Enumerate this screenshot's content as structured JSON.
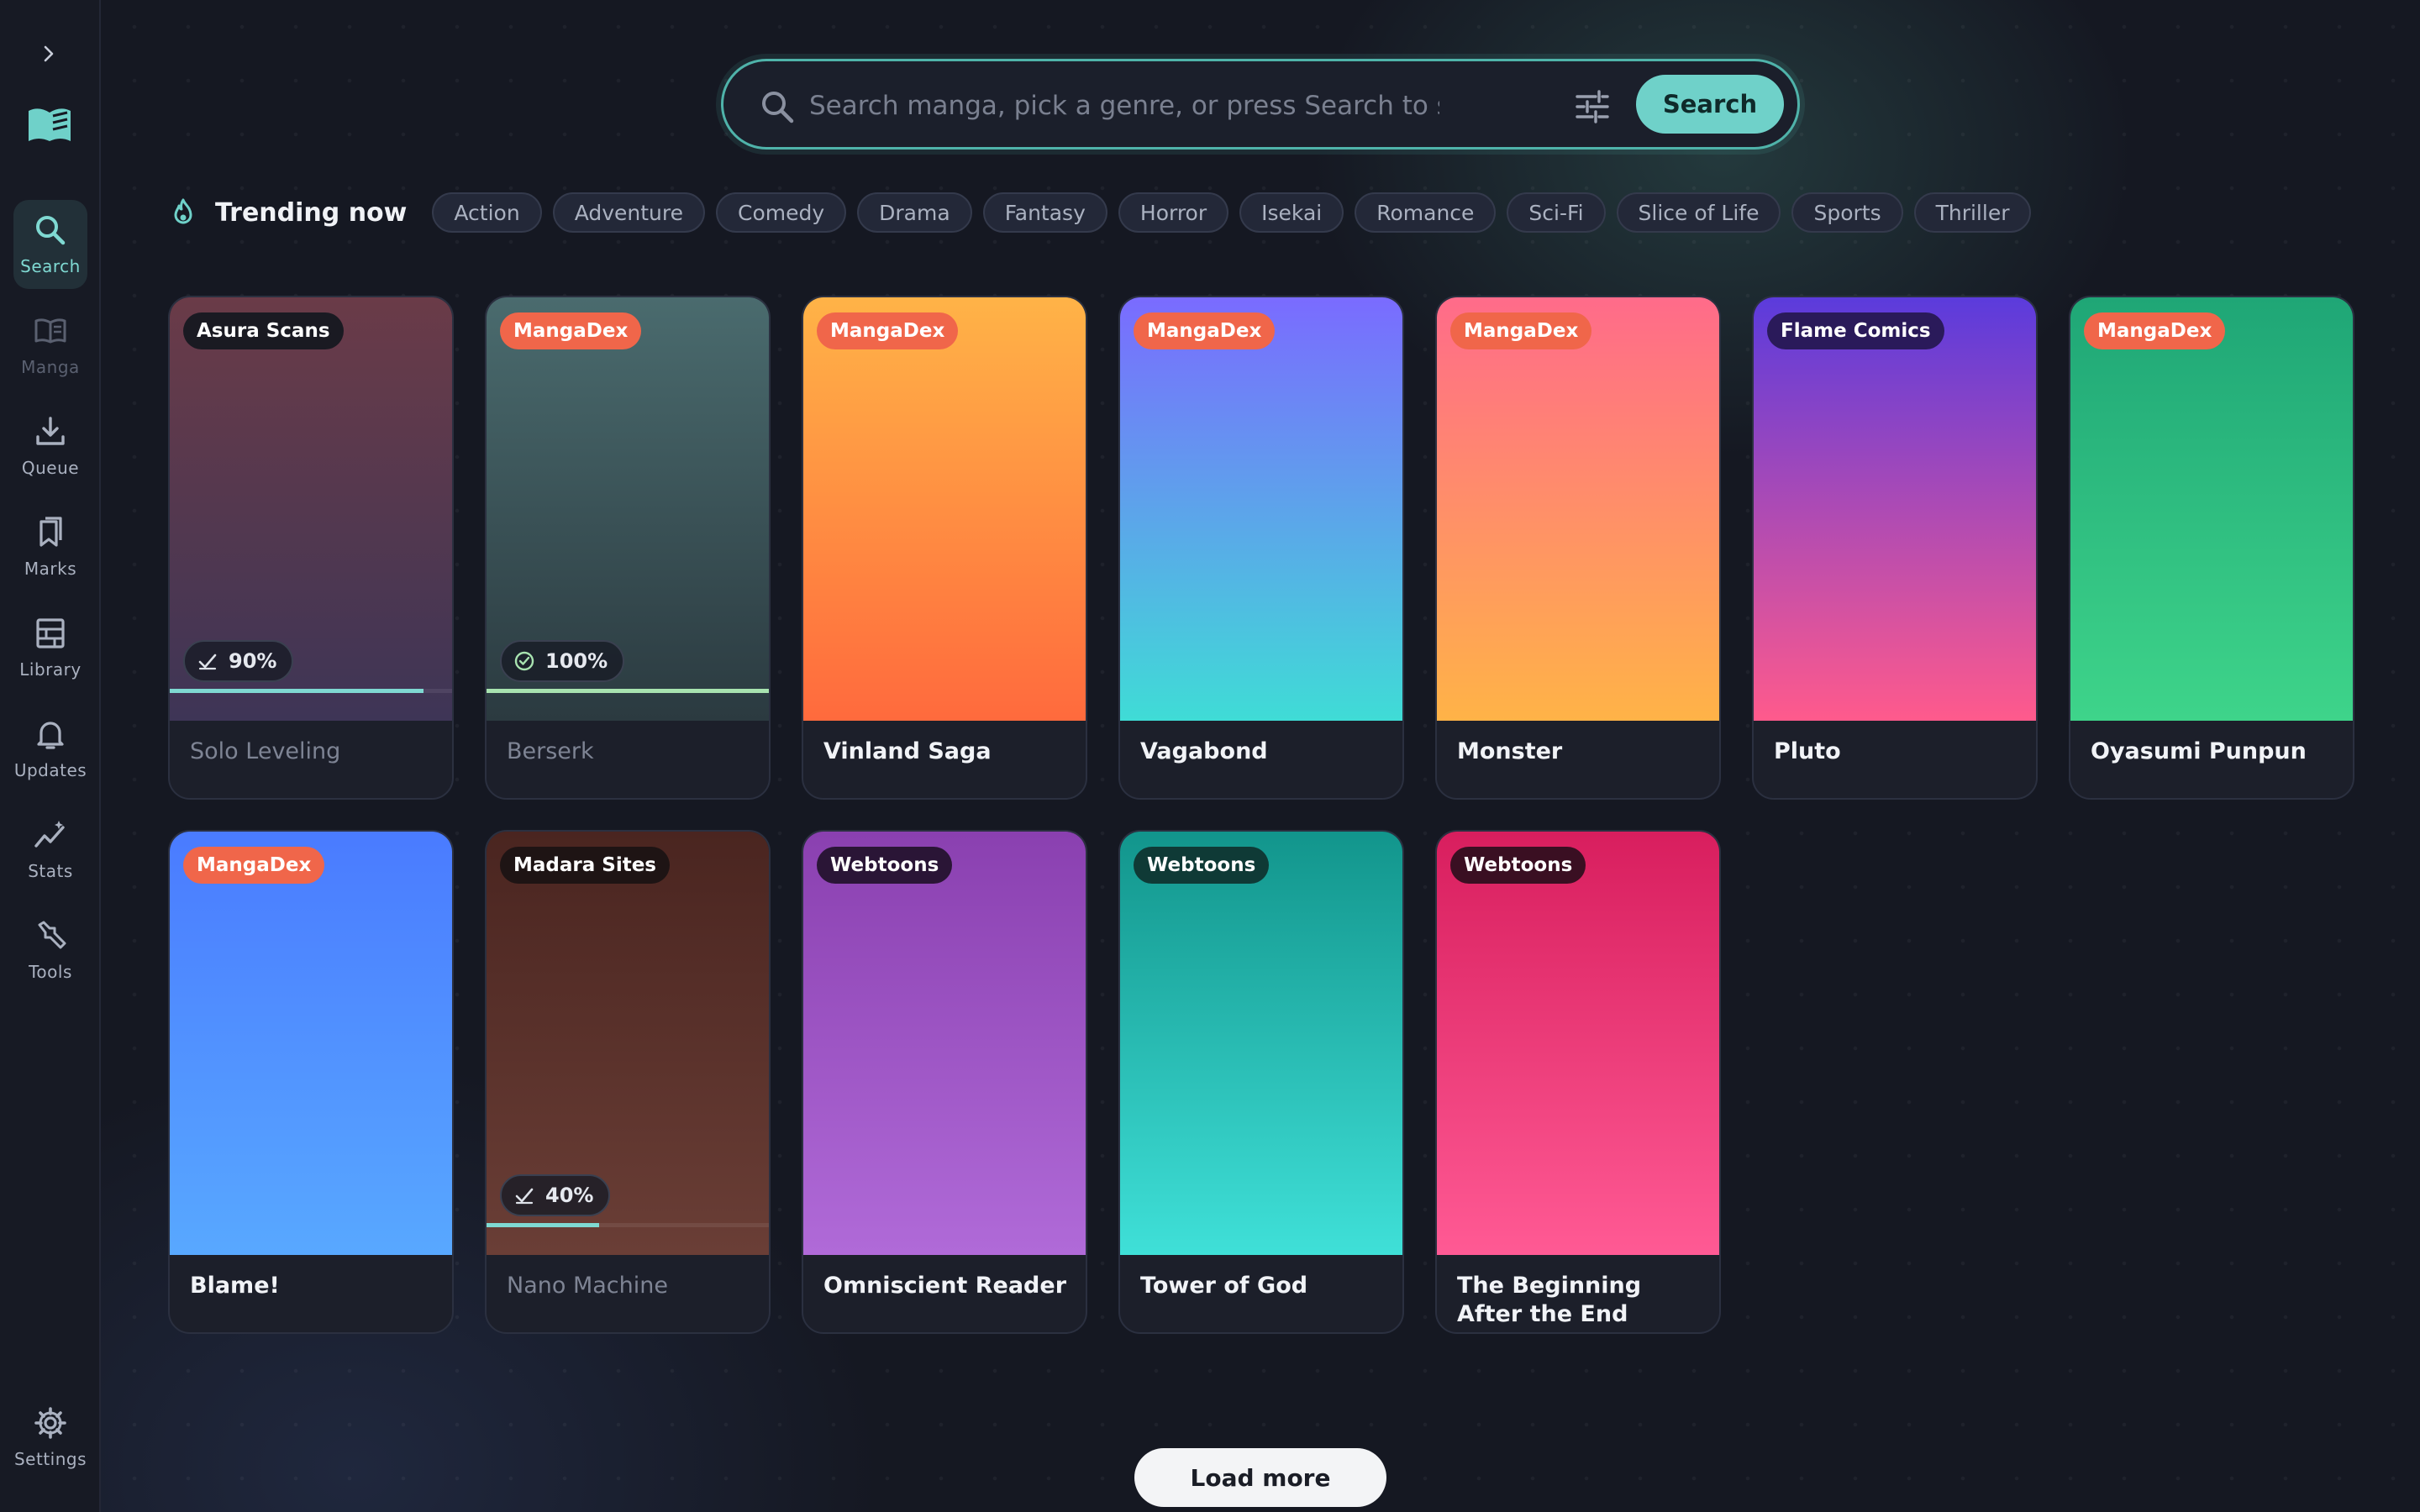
{
  "sidebar": {
    "items": [
      {
        "key": "search",
        "label": "Search",
        "icon": "search-icon",
        "active": true
      },
      {
        "key": "manga",
        "label": "Manga",
        "icon": "book-icon",
        "dim": true
      },
      {
        "key": "queue",
        "label": "Queue",
        "icon": "download-icon"
      },
      {
        "key": "marks",
        "label": "Marks",
        "icon": "bookmark-icon"
      },
      {
        "key": "library",
        "label": "Library",
        "icon": "library-icon"
      },
      {
        "key": "updates",
        "label": "Updates",
        "icon": "bell-icon"
      },
      {
        "key": "stats",
        "label": "Stats",
        "icon": "sparkline-icon"
      },
      {
        "key": "tools",
        "label": "Tools",
        "icon": "wrench-icon"
      }
    ],
    "settings_label": "Settings"
  },
  "search": {
    "placeholder": "Search manga, pick a genre, or press Search to see what's trending",
    "button_label": "Search"
  },
  "trending": {
    "title": "Trending now",
    "genres": [
      "Action",
      "Adventure",
      "Comedy",
      "Drama",
      "Fantasy",
      "Horror",
      "Isekai",
      "Romance",
      "Sci-Fi",
      "Slice of Life",
      "Sports",
      "Thriller"
    ]
  },
  "cards": [
    {
      "title": "Solo Leveling",
      "source": "Asura Scans",
      "badge_color": "#1a1a22",
      "grad": [
        "#6a3b48",
        "#3e3556"
      ],
      "progress": 90,
      "muted": true
    },
    {
      "title": "Berserk",
      "source": "MangaDex",
      "badge_color": "#f0664a",
      "grad": [
        "#4a6b6e",
        "#2b3a40"
      ],
      "progress": 100,
      "done": true,
      "muted": true
    },
    {
      "title": "Vinland Saga",
      "source": "MangaDex",
      "badge_color": "#f0664a",
      "grad": [
        "#ffb347",
        "#ff6a3d"
      ]
    },
    {
      "title": "Vagabond",
      "source": "MangaDex",
      "badge_color": "#f0664a",
      "grad": [
        "#7a6bff",
        "#3fdcd6"
      ]
    },
    {
      "title": "Monster",
      "source": "MangaDex",
      "badge_color": "#f0664a",
      "grad": [
        "#ff6b8a",
        "#ffb347"
      ]
    },
    {
      "title": "Pluto",
      "source": "Flame Comics",
      "badge_color": "#2a1a5a",
      "grad": [
        "#5b3bdc",
        "#ff5a8c"
      ]
    },
    {
      "title": "Oyasumi Punpun",
      "source": "MangaDex",
      "badge_color": "#f0664a",
      "grad": [
        "#1fa676",
        "#3ed48a"
      ]
    },
    {
      "title": "Blame!",
      "source": "MangaDex",
      "badge_color": "#f0664a",
      "grad": [
        "#4a7bff",
        "#58a8ff"
      ]
    },
    {
      "title": "Nano Machine",
      "source": "Madara Sites",
      "badge_color": "#1e1414",
      "grad": [
        "#4a2520",
        "#6a3e36"
      ],
      "progress": 40,
      "muted": true
    },
    {
      "title": "Omniscient Reader",
      "source": "Webtoons",
      "badge_color": "#2a1536",
      "grad": [
        "#8a40b0",
        "#b06ad8"
      ]
    },
    {
      "title": "Tower of God",
      "source": "Webtoons",
      "badge_color": "#0f3a36",
      "grad": [
        "#12958c",
        "#3fe0d8"
      ]
    },
    {
      "title": "The Beginning After the End",
      "source": "Webtoons",
      "badge_color": "#3a0f22",
      "grad": [
        "#d81e5e",
        "#ff5a94"
      ]
    }
  ],
  "load_more_label": "Load more"
}
